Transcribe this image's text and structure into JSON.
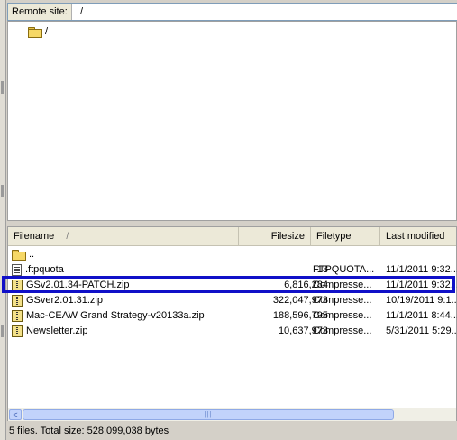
{
  "remote_site": {
    "label": "Remote site:",
    "path": "/"
  },
  "tree": {
    "root_label": "/",
    "root_icon": "folder-icon"
  },
  "file_list": {
    "columns": {
      "filename": "Filename",
      "sort_indicator": "/",
      "filesize": "Filesize",
      "filetype": "Filetype",
      "last_modified": "Last modified"
    },
    "rows": [
      {
        "icon": "folder-icon",
        "name": "..",
        "size": "",
        "type": "",
        "modified": ""
      },
      {
        "icon": "document-icon",
        "name": ".ftpquota",
        "size": "13",
        "type": "FTPQUOTA...",
        "modified": "11/1/2011 9:32..."
      },
      {
        "icon": "zip-icon",
        "name": "GSv2.01.34-PATCH.zip",
        "size": "6,816,284",
        "type": "Compresse...",
        "modified": "11/1/2011 9:32..."
      },
      {
        "icon": "zip-icon",
        "name": "GSver2.01.31.zip",
        "size": "322,047,973",
        "type": "Compresse...",
        "modified": "10/19/2011 9:1..."
      },
      {
        "icon": "zip-icon",
        "name": "Mac-CEAW Grand Strategy-v20133a.zip",
        "size": "188,596,795",
        "type": "Compresse...",
        "modified": "11/1/2011 8:44..."
      },
      {
        "icon": "zip-icon",
        "name": "Newsletter.zip",
        "size": "10,637,973",
        "type": "Compresse...",
        "modified": "5/31/2011 5:29..."
      }
    ],
    "highlighted_row": "GSv2.01.34-PATCH.zip"
  },
  "scrollbar": {
    "left_arrow": "<",
    "thumb_grip": "|||"
  },
  "status_bar": {
    "text": "5 files. Total size: 528,099,038 bytes"
  },
  "colors": {
    "highlight_border": "#1010c8",
    "window_bg": "#d4d0c8"
  }
}
